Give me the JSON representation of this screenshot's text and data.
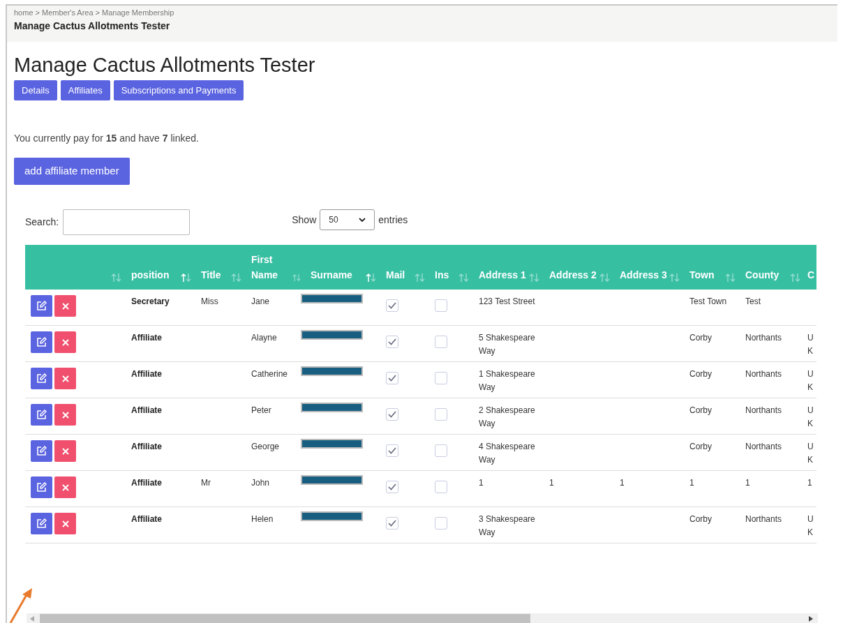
{
  "breadcrumb": {
    "items": [
      "home",
      "Member's Area",
      "Manage Membership"
    ],
    "separator": ">",
    "current": "Manage Cactus Allotments Tester"
  },
  "heading": "Manage Cactus Allotments Tester",
  "tabs": [
    {
      "label": "Details"
    },
    {
      "label": "Affiliates"
    },
    {
      "label": "Subscriptions and Payments"
    }
  ],
  "summary": "You currently pay for **15** and have **7** linked.",
  "add_button": "add affiliate member",
  "search": {
    "label": "Search:"
  },
  "length": {
    "before": "Show",
    "value": "50",
    "after": "entries"
  },
  "table": {
    "columns": [
      {
        "sorted": false
      },
      {
        "label": "position",
        "sorted": true
      },
      {
        "label": "Title",
        "sorted": false
      },
      {
        "label": "First Name",
        "sorted": false
      },
      {
        "label": "Surname",
        "sorted": true
      },
      {
        "label": "Mail",
        "sorted": false
      },
      {
        "label": "Ins",
        "sorted": false
      },
      {
        "label": "Address 1",
        "sorted": false
      },
      {
        "label": "Address 2",
        "sorted": false
      },
      {
        "label": "Address 3",
        "sorted": false
      },
      {
        "label": "Town",
        "sorted": false
      },
      {
        "label": "County",
        "sorted": false
      },
      {
        "label": "C"
      }
    ],
    "rows": [
      {
        "position": "Secretary",
        "title": "Miss",
        "first_name": "Jane",
        "mail": true,
        "ins": false,
        "address_1": "123 Test Street",
        "town": "Test Town",
        "county": "Test"
      },
      {
        "position": "Affiliate",
        "first_name": "Alayne",
        "mail": true,
        "ins": false,
        "address_1": "5 Shakespeare Way",
        "town": "Corby",
        "county": "Northants",
        "column_13": "U K"
      },
      {
        "position": "Affiliate",
        "first_name": "Catherine",
        "mail": true,
        "ins": false,
        "address_1": "1 Shakespeare Way",
        "town": "Corby",
        "county": "Northants",
        "column_13": "U K"
      },
      {
        "position": "Affiliate",
        "first_name": "Peter",
        "mail": true,
        "ins": false,
        "address_1": "2 Shakespeare Way",
        "town": "Corby",
        "county": "Northants",
        "column_13": "U K"
      },
      {
        "position": "Affiliate",
        "first_name": "George",
        "mail": true,
        "ins": false,
        "address_1": "4 Shakespeare Way",
        "town": "Corby",
        "county": "Northants",
        "column_13": "U K"
      },
      {
        "position": "Affiliate",
        "title": "Mr",
        "first_name": "John",
        "mail": true,
        "ins": false,
        "address_1": "1",
        "address_2": "1",
        "address_3": "1",
        "town": "1",
        "county": "1",
        "column_13": "1"
      },
      {
        "position": "Affiliate",
        "first_name": "Helen",
        "mail": true,
        "ins": false,
        "address_1": "3 Shakespeare Way",
        "town": "Corby",
        "county": "Northants",
        "column_13": "U K"
      }
    ]
  }
}
